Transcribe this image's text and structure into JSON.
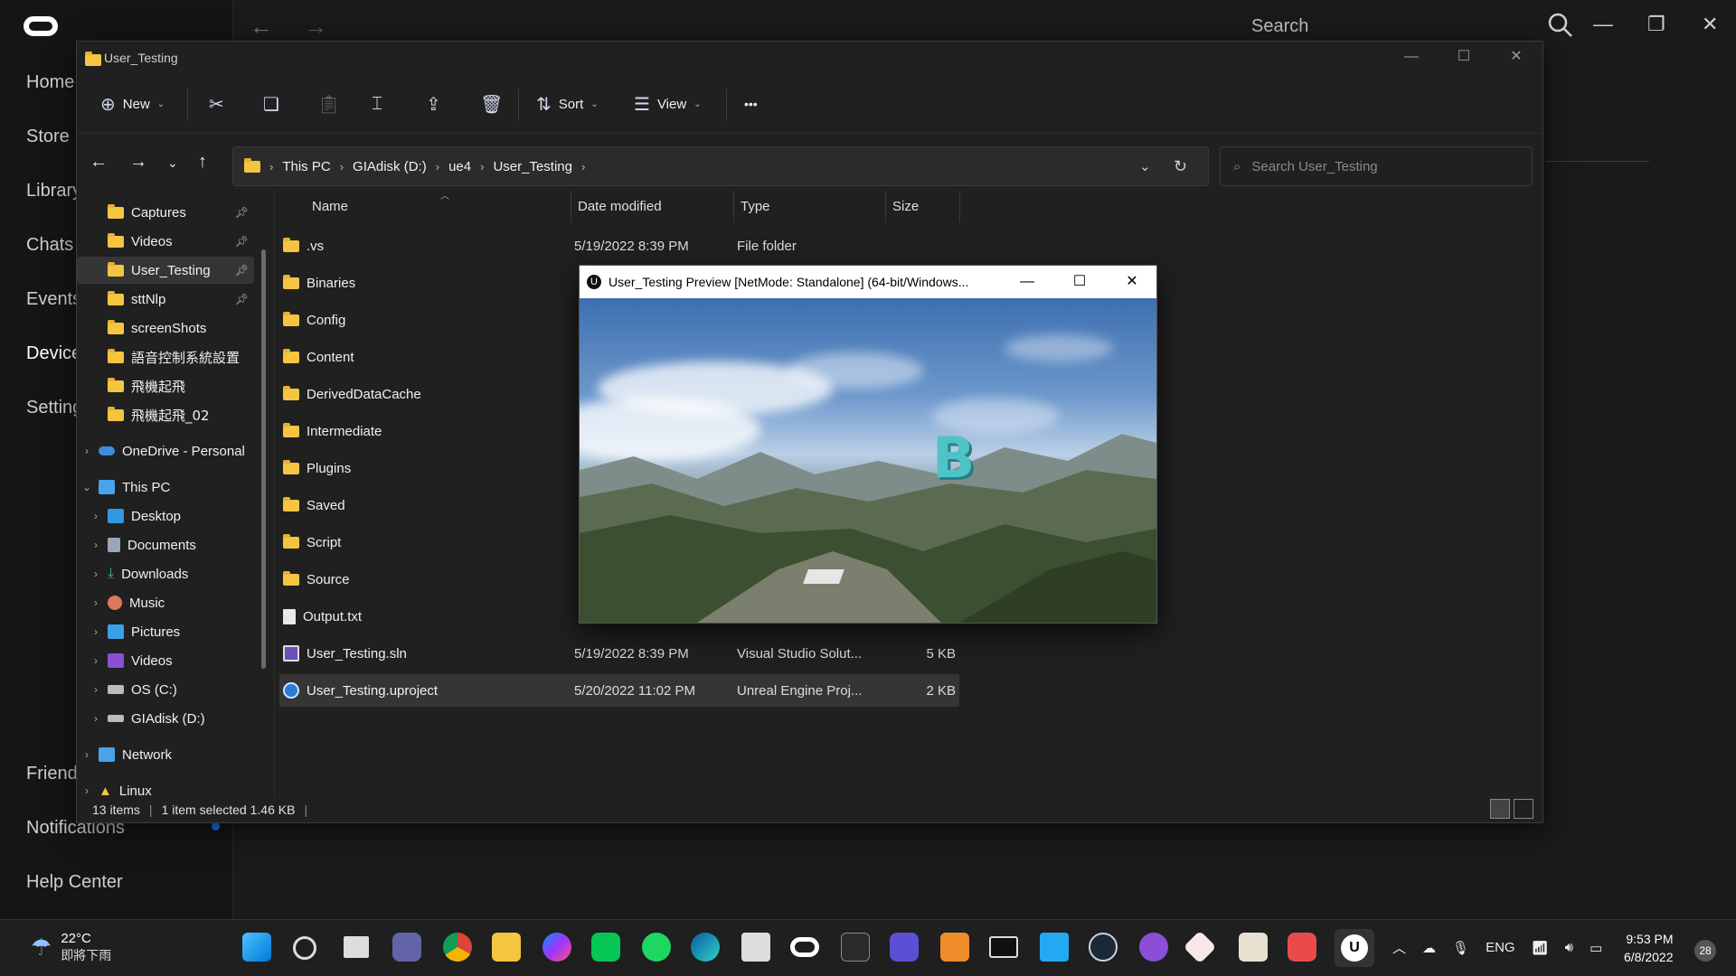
{
  "oculus": {
    "nav": [
      "Home",
      "Store",
      "Library",
      "Chats",
      "Events",
      "Devices",
      "Settings",
      "Friends",
      "Notifications",
      "Help Center"
    ],
    "search_label": "Search"
  },
  "explorer": {
    "title": "User_Testing",
    "toolbar": {
      "new_label": "New",
      "sort_label": "Sort",
      "view_label": "View",
      "more_label": "•••"
    },
    "breadcrumb": [
      "This PC",
      "GIAdisk (D:)",
      "ue4",
      "User_Testing"
    ],
    "search_placeholder": "Search User_Testing",
    "nav_items": [
      {
        "label": "Captures",
        "pinned": true
      },
      {
        "label": "Videos",
        "pinned": true
      },
      {
        "label": "User_Testing",
        "pinned": true,
        "selected": true
      },
      {
        "label": "sttNlp",
        "pinned": true
      },
      {
        "label": "screenShots"
      },
      {
        "label": "語音控制系統設置"
      },
      {
        "label": "飛機起飛"
      },
      {
        "label": "飛機起飛_02"
      },
      {
        "label": "OneDrive - Personal"
      },
      {
        "label": "This PC"
      },
      {
        "label": "Desktop"
      },
      {
        "label": "Documents"
      },
      {
        "label": "Downloads"
      },
      {
        "label": "Music"
      },
      {
        "label": "Pictures"
      },
      {
        "label": "Videos"
      },
      {
        "label": "OS (C:)"
      },
      {
        "label": "GIAdisk (D:)"
      },
      {
        "label": "Network"
      },
      {
        "label": "Linux"
      }
    ],
    "columns": [
      "Name",
      "Date modified",
      "Type",
      "Size"
    ],
    "files": [
      {
        "name": ".vs",
        "date": "5/19/2022 8:39 PM",
        "type": "File folder",
        "size": ""
      },
      {
        "name": "Binaries",
        "date": "",
        "type": "",
        "size": ""
      },
      {
        "name": "Config",
        "date": "",
        "type": "",
        "size": ""
      },
      {
        "name": "Content",
        "date": "",
        "type": "",
        "size": ""
      },
      {
        "name": "DerivedDataCache",
        "date": "",
        "type": "",
        "size": ""
      },
      {
        "name": "Intermediate",
        "date": "",
        "type": "",
        "size": ""
      },
      {
        "name": "Plugins",
        "date": "",
        "type": "",
        "size": ""
      },
      {
        "name": "Saved",
        "date": "",
        "type": "",
        "size": ""
      },
      {
        "name": "Script",
        "date": "",
        "type": "",
        "size": ""
      },
      {
        "name": "Source",
        "date": "",
        "type": "",
        "size": ""
      },
      {
        "name": "Output.txt",
        "date": "",
        "type": "",
        "size": ""
      },
      {
        "name": "User_Testing.sln",
        "date": "5/19/2022 8:39 PM",
        "type": "Visual Studio Solut...",
        "size": "5 KB"
      },
      {
        "name": "User_Testing.uproject",
        "date": "5/20/2022 11:02 PM",
        "type": "Unreal Engine Proj...",
        "size": "2 KB"
      }
    ],
    "status": {
      "items": "13 items",
      "selected": "1 item selected  1.46 KB"
    }
  },
  "preview": {
    "title": "User_Testing Preview [NetMode: Standalone]  (64-bit/Windows...",
    "scene_letter": "B"
  },
  "taskbar": {
    "weather_temp": "22°C",
    "weather_desc": "即將下雨",
    "lang": "ENG",
    "time": "9:53 PM",
    "date": "6/8/2022",
    "notif_count": "28"
  }
}
